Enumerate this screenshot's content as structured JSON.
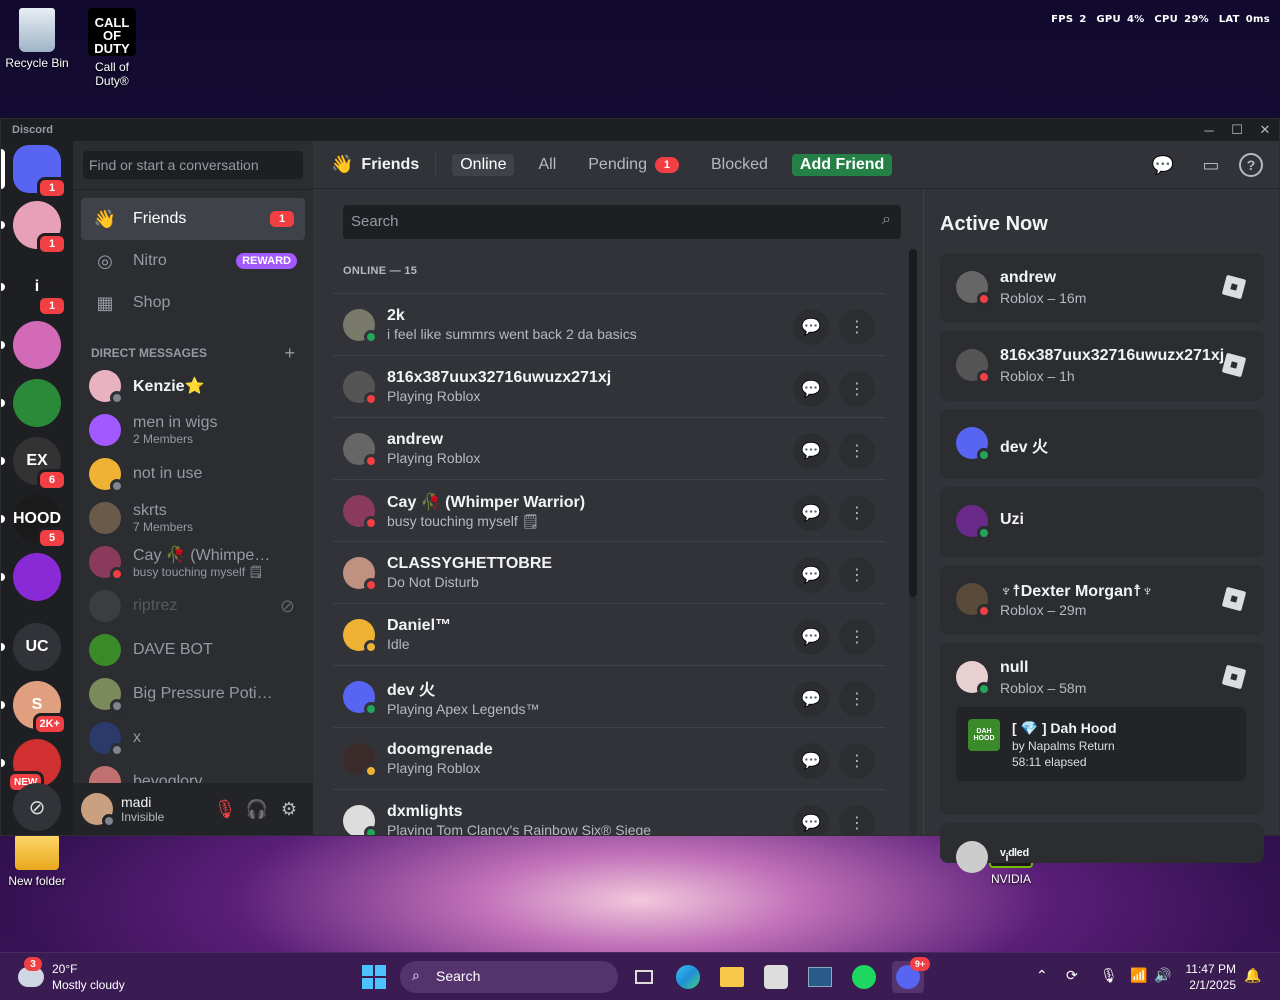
{
  "desktop": {
    "icons": [
      {
        "label": "Recycle Bin",
        "icon": "recycle-bin-icon"
      },
      {
        "label": "Call of Duty®",
        "icon": "call-of-duty-icon"
      },
      {
        "label": "New folder",
        "icon": "folder-icon"
      },
      {
        "label": "NVIDIA",
        "icon": "nvidia-icon"
      }
    ],
    "cod_logo": "CALL OF DUTY",
    "perf": {
      "fps_label": "FPS",
      "fps": "2",
      "gpu_label": "GPU",
      "gpu": "4%",
      "cpu_label": "CPU",
      "cpu": "29%",
      "lat_label": "LAT",
      "lat": "0ms"
    }
  },
  "window": {
    "title": "Discord"
  },
  "servers": [
    {
      "name": "home",
      "badge": "1",
      "color": "#5865f2"
    },
    {
      "name": "dm-avatar",
      "badge": "1",
      "color": "#e8a0b8"
    },
    {
      "name": "server-i",
      "badge": "1",
      "letter": "i",
      "color": "#1e1f22"
    },
    {
      "name": "server-pink",
      "badge": "",
      "color": "#d26ab8"
    },
    {
      "name": "server-money",
      "badge": "",
      "color": "#2a8a3a"
    },
    {
      "name": "server-ex",
      "badge": "6",
      "letter": "EX",
      "color": "#333"
    },
    {
      "name": "server-hood",
      "badge": "5",
      "letter": "HOOD",
      "color": "#1a1a1a"
    },
    {
      "name": "server-purple",
      "badge": "",
      "color": "#8a2ad6"
    },
    {
      "name": "server-uc",
      "badge": "",
      "letter": "UC",
      "color": "#313338"
    },
    {
      "name": "server-s",
      "badge": "2K+",
      "letter": "S",
      "color": "#e0a080"
    },
    {
      "name": "server-new",
      "badge": "NEW",
      "color": "#d03030"
    }
  ],
  "sidebar": {
    "search_placeholder": "Find or start a conversation",
    "nav": [
      {
        "label": "Friends",
        "badge": "1"
      },
      {
        "label": "Nitro",
        "tag": "REWARD"
      },
      {
        "label": "Shop"
      }
    ],
    "dm_header": "DIRECT MESSAGES",
    "dm_add": "+",
    "dms": [
      {
        "name": "Kenzie⭐",
        "sub": "",
        "color": "#e9b2c0",
        "status": "#80848e"
      },
      {
        "name": "men in wigs",
        "sub": "2 Members",
        "color": "#a259ff",
        "status": ""
      },
      {
        "name": "not in use",
        "sub": "",
        "color": "#f0b232",
        "status": "#80848e"
      },
      {
        "name": "skrts",
        "sub": "7 Members",
        "color": "#6a5a4a",
        "status": ""
      },
      {
        "name": "Cay 🥀 (Whimper Warr...",
        "sub": "busy touching myself 🗒",
        "color": "#8a3a5a",
        "status": "#f23f43"
      },
      {
        "name": "riptrez",
        "sub": "",
        "color": "#555",
        "status": "",
        "dim": true
      },
      {
        "name": "DAVE BOT",
        "sub": "",
        "color": "#3a8a2a",
        "status": ""
      },
      {
        "name": "Big Pressure Potions",
        "sub": "",
        "color": "#7a8a5a",
        "status": "#80848e"
      },
      {
        "name": "x",
        "sub": "",
        "color": "#2a3a6a",
        "status": "#80848e"
      },
      {
        "name": "beyoglory",
        "sub": "",
        "color": "#c07070",
        "status": ""
      }
    ],
    "user": {
      "name": "madi",
      "status": "Invisible"
    }
  },
  "topbar": {
    "title": "Friends",
    "tabs": [
      {
        "label": "Online",
        "active": true
      },
      {
        "label": "All"
      },
      {
        "label": "Pending",
        "badge": "1"
      },
      {
        "label": "Blocked"
      }
    ],
    "add_friend": "Add Friend"
  },
  "friends": {
    "search_placeholder": "Search",
    "online_header": "ONLINE — 15",
    "list": [
      {
        "name": "2k",
        "activity": "i feel like summrs went back 2 da basics",
        "color": "#7a7a6a",
        "status": "#23a55a"
      },
      {
        "name": "816x387uux32716uwuzx271xj",
        "activity": "Playing Roblox",
        "color": "#555",
        "status": "#f23f43"
      },
      {
        "name": "andrew",
        "activity": "Playing Roblox",
        "color": "#666",
        "status": "#f23f43"
      },
      {
        "name": "Cay 🥀 (Whimper Warrior)",
        "activity": "busy touching myself 🗒",
        "color": "#8a3a5a",
        "status": "#f23f43"
      },
      {
        "name": "CLASSYGHETTOBRE",
        "activity": "Do Not Disturb",
        "color": "#c09080",
        "status": "#f23f43"
      },
      {
        "name": "Daniel™",
        "activity": "Idle",
        "color": "#f0b232",
        "status": "#f0b232"
      },
      {
        "name": "dev 火",
        "activity": "Playing Apex Legends™",
        "color": "#5865f2",
        "status": "#23a55a"
      },
      {
        "name": "doomgrenade",
        "activity": "Playing Roblox",
        "color": "#3a2a2a",
        "status": "#f0b232"
      },
      {
        "name": "dxmlights",
        "activity": "Playing Tom Clancy's Rainbow Six® Siege",
        "color": "#ddd",
        "status": "#23a55a"
      }
    ]
  },
  "active_now": {
    "title": "Active Now",
    "cards": [
      {
        "name": "andrew",
        "activity": "Roblox – 16m",
        "color": "#666",
        "status": "#f23f43",
        "game": true
      },
      {
        "name": "816x387uux32716uwuzx271xj",
        "activity": "Roblox – 1h",
        "color": "#555",
        "status": "#f23f43",
        "game": true
      },
      {
        "name": "dev 火",
        "activity": "",
        "color": "#5865f2",
        "status": "#23a55a",
        "game": false
      },
      {
        "name": "Uzi",
        "activity": "",
        "color": "#6a2a8a",
        "status": "#23a55a",
        "game": false
      },
      {
        "name": "♆☨Dexter Morgan☨♆",
        "activity": "Roblox – 29m",
        "color": "#5a4a3a",
        "status": "#f23f43",
        "game": true
      },
      {
        "name": "null",
        "activity": "Roblox – 58m",
        "color": "#e8d0d0",
        "status": "#23a55a",
        "game": true
      },
      {
        "name": "ᵛᵢᵈˡᵉᵈ",
        "activity": "",
        "color": "#ccc",
        "status": "",
        "game": false
      }
    ],
    "sub": {
      "title": "[ 💎 ] Dah Hood",
      "by": "by Napalms Return",
      "elapsed": "58:11 elapsed",
      "thumb_text": "DAH HOOD"
    }
  },
  "taskbar": {
    "weather_temp": "20°F",
    "weather_desc": "Mostly cloudy",
    "weather_badge": "3",
    "search": "Search",
    "discord_badge": "9+",
    "time": "11:47 PM",
    "date": "2/1/2025"
  }
}
